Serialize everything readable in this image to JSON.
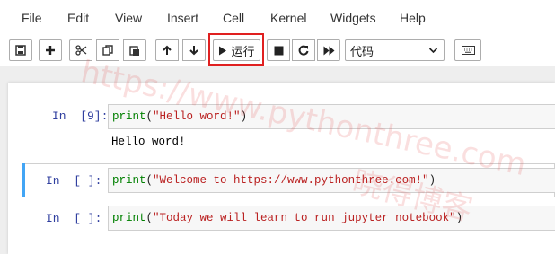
{
  "menu": {
    "file": "File",
    "edit": "Edit",
    "view": "View",
    "insert": "Insert",
    "cell": "Cell",
    "kernel": "Kernel",
    "widgets": "Widgets",
    "help": "Help"
  },
  "toolbar": {
    "run_label": "运行",
    "cell_type": "代码"
  },
  "cells": [
    {
      "prompt": "In  [9]:",
      "func": "print",
      "open": "(",
      "string": "\"Hello word!\"",
      "close": ")",
      "output": "Hello word!"
    },
    {
      "prompt": "In  [ ]:",
      "func": "print",
      "open": "(",
      "string": "\"Welcome to https://www.pythonthree.com!\"",
      "close": ")"
    },
    {
      "prompt": "In  [ ]:",
      "func": "print",
      "open": "(",
      "string": "\"Today we will learn to run jupyter notebook\"",
      "close": ")"
    }
  ],
  "watermark": {
    "url": "https://www.pythonthree.com",
    "cn": "晓得博客"
  },
  "colors": {
    "highlight": "#e02020",
    "selected_cell": "#42a5f5",
    "prompt": "#303f9f",
    "keyword": "#008000",
    "string": "#ba2121"
  }
}
